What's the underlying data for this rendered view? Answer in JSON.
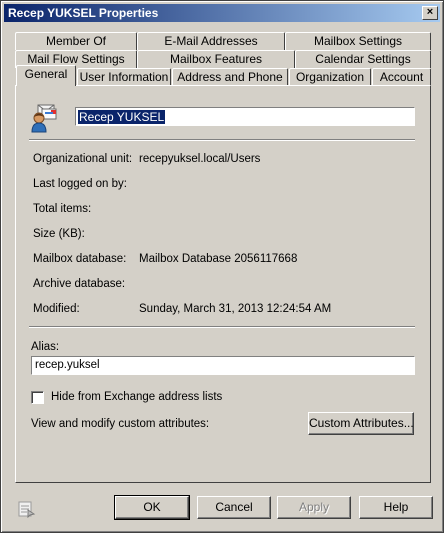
{
  "window": {
    "title": "Recep YUKSEL Properties",
    "close_glyph": "×"
  },
  "tabs": {
    "row1": [
      "Member Of",
      "E-Mail Addresses",
      "Mailbox Settings"
    ],
    "row2": [
      "Mail Flow Settings",
      "Mailbox Features",
      "Calendar Settings"
    ],
    "row3": [
      "General",
      "User Information",
      "Address and Phone",
      "Organization",
      "Account"
    ],
    "active": "General"
  },
  "general": {
    "display_name": "Recep YUKSEL",
    "fields": [
      {
        "label": "Organizational unit:",
        "value": "recepyuksel.local/Users"
      },
      {
        "label": "Last logged on by:",
        "value": ""
      },
      {
        "label": "Total items:",
        "value": ""
      },
      {
        "label": "Size (KB):",
        "value": ""
      },
      {
        "label": "Mailbox database:",
        "value": "Mailbox Database 2056117668"
      },
      {
        "label": "Archive database:",
        "value": ""
      },
      {
        "label": "Modified:",
        "value": "Sunday, March 31, 2013 12:24:54 AM"
      }
    ],
    "alias_label": "Alias:",
    "alias_value": "recep.yuksel",
    "hide_checkbox_label": "Hide from Exchange address lists",
    "hide_checked": false,
    "custom_attr_label": "View and modify custom attributes:",
    "custom_attr_button": "Custom Attributes..."
  },
  "buttons": {
    "ok": "OK",
    "cancel": "Cancel",
    "apply": "Apply",
    "help": "Help"
  },
  "icons": {
    "mailbox": "mailbox-user-icon",
    "bottom": "command-log-icon"
  },
  "colors": {
    "titlebar_start": "#0a246a",
    "titlebar_end": "#a6caf0",
    "face": "#d4d0c8",
    "selection": "#0a246a"
  }
}
